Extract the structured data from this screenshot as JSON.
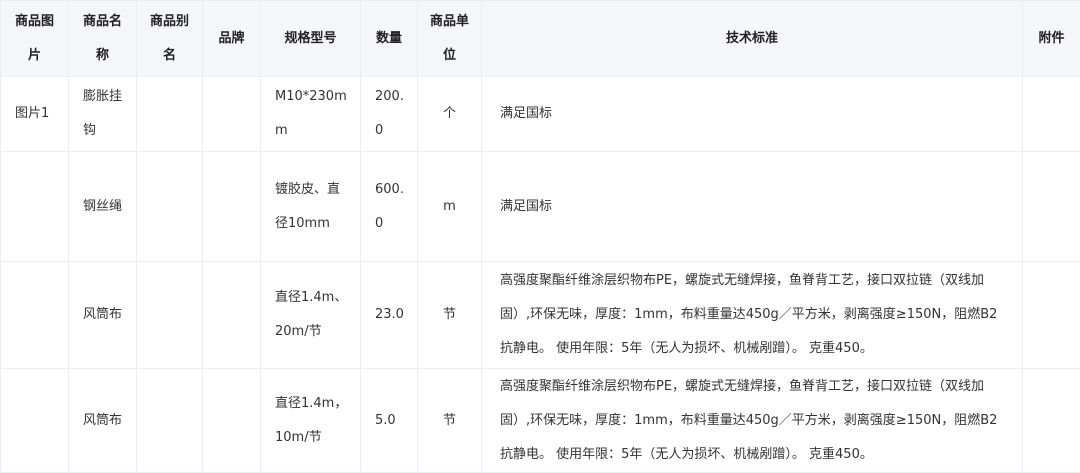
{
  "headers": {
    "image": "商品图片",
    "name": "商品名称",
    "alias": "商品别名",
    "brand": "品牌",
    "spec": "规格型号",
    "qty": "数量",
    "unit": "商品单位",
    "standard": "技术标准",
    "attachment": "附件"
  },
  "rows": [
    {
      "image": "图片1",
      "name": "膨胀挂钩",
      "alias": "",
      "brand": "",
      "spec": "M10*230mm",
      "qty": "200.0",
      "unit": "个",
      "standard": "满足国标",
      "attachment": ""
    },
    {
      "image": "",
      "name": "钢丝绳",
      "alias": "",
      "brand": "",
      "spec": "镀胶皮、直径10mm",
      "qty": "600.0",
      "unit": "m",
      "standard": "满足国标",
      "attachment": ""
    },
    {
      "image": "",
      "name": "风筒布",
      "alias": "",
      "brand": "",
      "spec": "直径1.4m、20m/节",
      "qty": "23.0",
      "unit": "节",
      "standard": "高强度聚酯纤维涂层织物布PE，螺旋式无缝焊接，鱼脊背工艺，接口双拉链（双线加固）,环保无味，厚度：1mm，布料重量达450g／平方米，剥离强度≥150N，阻燃B2抗静电。 使用年限：5年（无人为损坏、机械剐蹭）。 克重450。",
      "attachment": ""
    },
    {
      "image": "",
      "name": "风筒布",
      "alias": "",
      "brand": "",
      "spec": "直径1.4m，10m/节",
      "qty": "5.0",
      "unit": "节",
      "standard": "高强度聚酯纤维涂层织物布PE，螺旋式无缝焊接，鱼脊背工艺，接口双拉链（双线加固）,环保无味，厚度：1mm，布料重量达450g／平方米，剥离强度≥150N，阻燃B2抗静电。 使用年限：5年（无人为损坏、机械剐蹭）。 克重450。",
      "attachment": ""
    }
  ]
}
